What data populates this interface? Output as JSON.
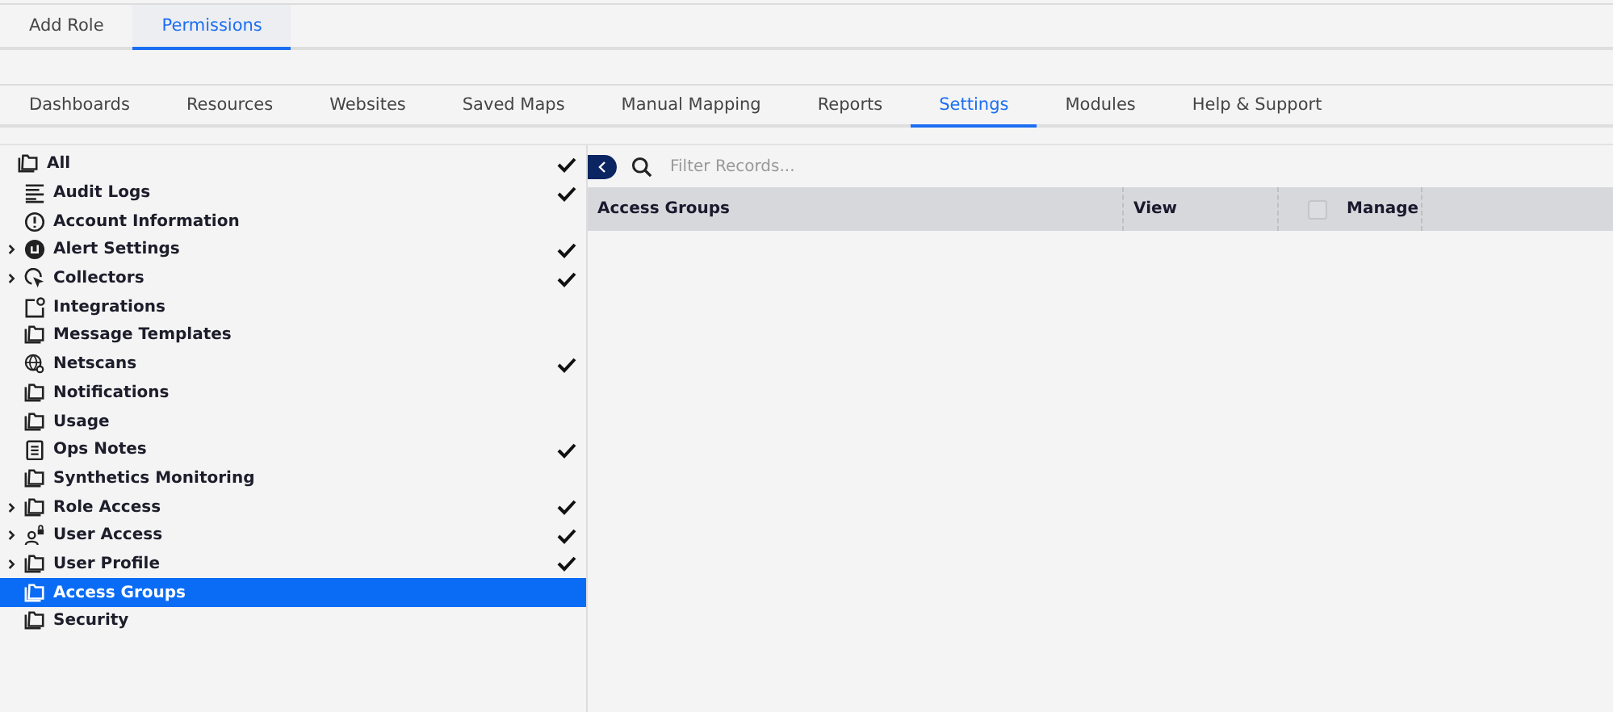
{
  "role_tabs": [
    {
      "label": "Add Role",
      "selected": false
    },
    {
      "label": "Permissions",
      "selected": true
    }
  ],
  "module_tabs": [
    {
      "label": "Dashboards",
      "selected": false
    },
    {
      "label": "Resources",
      "selected": false
    },
    {
      "label": "Websites",
      "selected": false
    },
    {
      "label": "Saved Maps",
      "selected": false
    },
    {
      "label": "Manual Mapping",
      "selected": false
    },
    {
      "label": "Reports",
      "selected": false
    },
    {
      "label": "Settings",
      "selected": true
    },
    {
      "label": "Modules",
      "selected": false
    },
    {
      "label": "Help & Support",
      "selected": false
    }
  ],
  "tree": [
    {
      "label": "All",
      "kind": "folder",
      "checked": true,
      "selected": false,
      "children": [
        {
          "label": "Audit Logs",
          "kind": "list",
          "expandable": false,
          "checked": true,
          "selected": false
        },
        {
          "label": "Account Information",
          "kind": "info",
          "expandable": false,
          "checked": false,
          "selected": false
        },
        {
          "label": "Alert Settings",
          "kind": "alert",
          "expandable": true,
          "checked": true,
          "selected": false
        },
        {
          "label": "Collectors",
          "kind": "collector",
          "expandable": true,
          "checked": true,
          "selected": false
        },
        {
          "label": "Integrations",
          "kind": "integration",
          "expandable": false,
          "checked": false,
          "selected": false
        },
        {
          "label": "Message Templates",
          "kind": "folder",
          "expandable": false,
          "checked": false,
          "selected": false
        },
        {
          "label": "Netscans",
          "kind": "globe",
          "expandable": false,
          "checked": true,
          "selected": false
        },
        {
          "label": "Notifications",
          "kind": "folder",
          "expandable": false,
          "checked": false,
          "selected": false
        },
        {
          "label": "Usage",
          "kind": "folder",
          "expandable": false,
          "checked": false,
          "selected": false
        },
        {
          "label": "Ops Notes",
          "kind": "notes",
          "expandable": false,
          "checked": true,
          "selected": false
        },
        {
          "label": "Synthetics Monitoring",
          "kind": "folder",
          "expandable": false,
          "checked": false,
          "selected": false
        },
        {
          "label": "Role Access",
          "kind": "folder",
          "expandable": true,
          "checked": true,
          "selected": false
        },
        {
          "label": "User Access",
          "kind": "user",
          "expandable": true,
          "checked": true,
          "selected": false
        },
        {
          "label": "User Profile",
          "kind": "folder",
          "expandable": true,
          "checked": true,
          "selected": false
        },
        {
          "label": "Access Groups",
          "kind": "folder",
          "expandable": false,
          "checked": false,
          "selected": true
        },
        {
          "label": "Security",
          "kind": "folder",
          "expandable": false,
          "checked": false,
          "selected": false
        }
      ]
    }
  ],
  "filter": {
    "placeholder": "Filter Records..."
  },
  "table": {
    "columns": [
      {
        "label": "Access Groups",
        "kind": "text"
      },
      {
        "label": "View",
        "kind": "text"
      },
      {
        "label": "Manage",
        "kind": "checkbox",
        "checked": false
      }
    ]
  }
}
